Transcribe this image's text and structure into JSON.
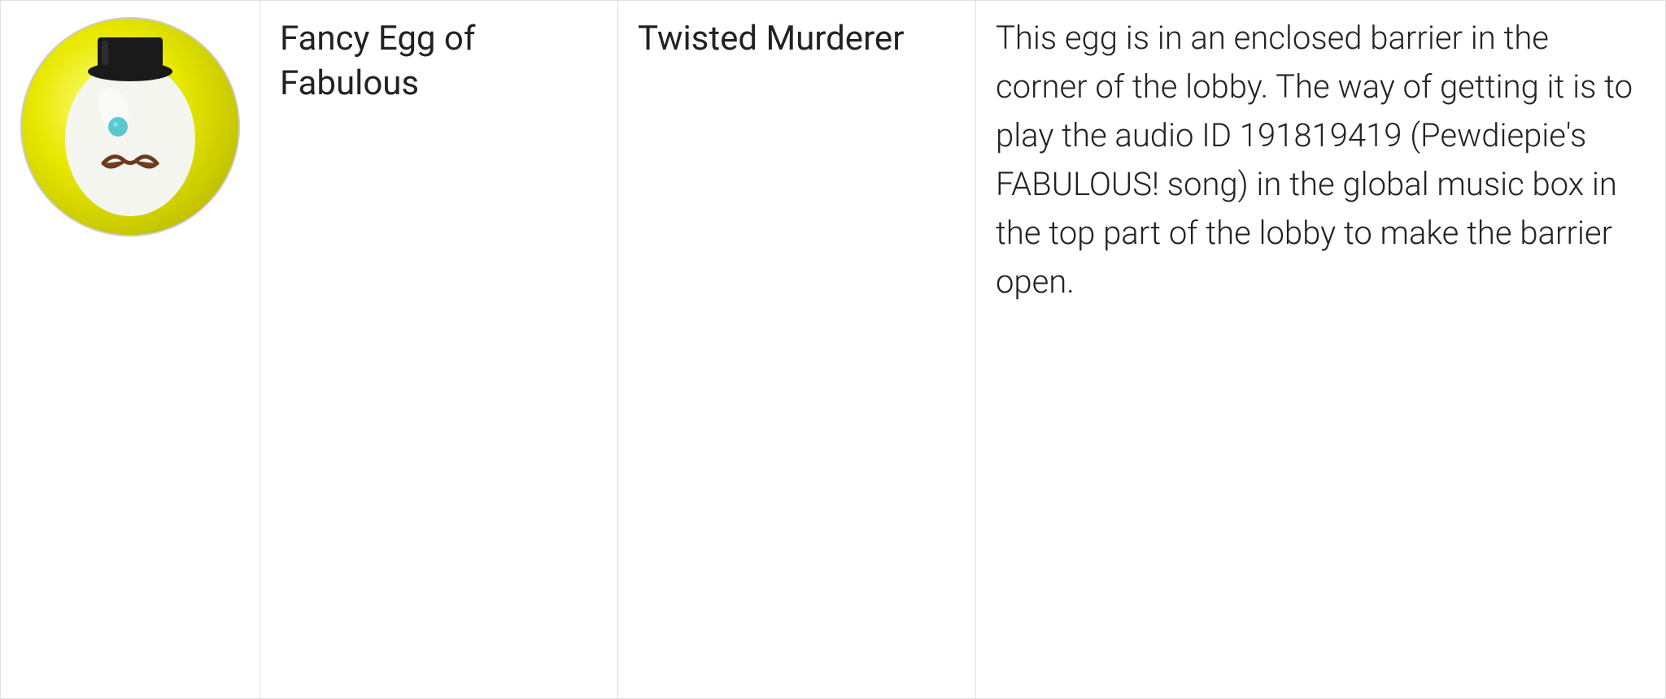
{
  "row": {
    "egg_name": "Fancy Egg of Fabulous",
    "game_name": "Twisted Murderer",
    "description": "This egg is in an enclosed barrier in the corner of the lobby. The way of getting it is to play the audio ID 191819419 (Pewdiepie's FABULOUS! song) in the global music box in the top part of the lobby to make the barrier open.",
    "image_alt": "Fancy Egg of Fabulous"
  }
}
